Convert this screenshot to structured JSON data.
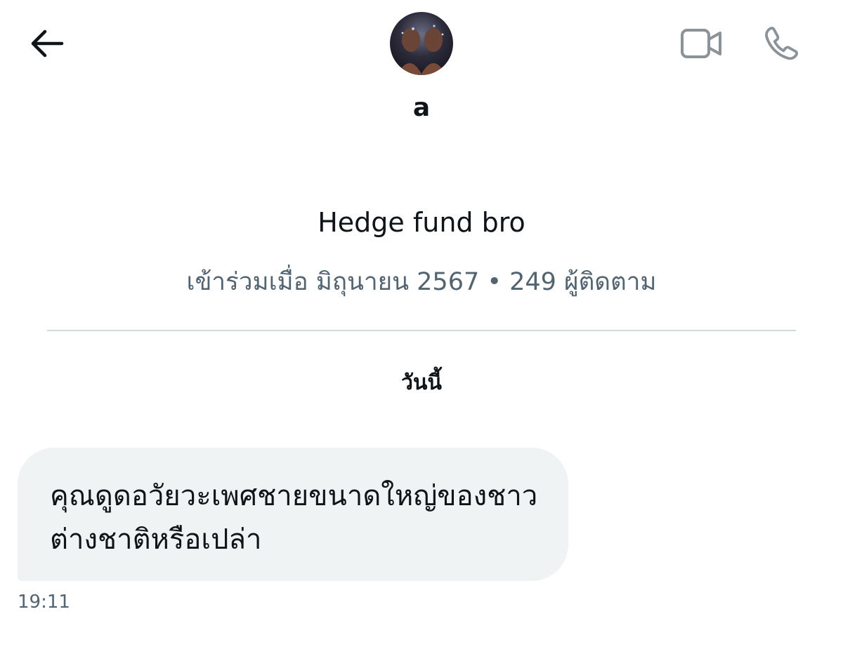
{
  "header": {
    "name": "a",
    "icons": {
      "back": "arrow-left-icon",
      "video": "video-camera-icon",
      "call": "phone-icon"
    }
  },
  "profile": {
    "bio": "Hedge fund bro",
    "meta": "เข้าร่วมเมื่อ มิถุนายน 2567 • 249 ผู้ติดตาม"
  },
  "conversation": {
    "date_label": "วันนี้",
    "messages": [
      {
        "text": "คุณดูดอวัยวะเพศชายขนาดใหญ่ของชาวต่างชาติหรือเปล่า",
        "time": "19:11"
      }
    ]
  },
  "colors": {
    "text": "#0f1419",
    "secondary_text": "#536471",
    "bubble_bg": "#eff3f4",
    "divider": "#cfd9de",
    "icon_gray": "#8b9399"
  }
}
